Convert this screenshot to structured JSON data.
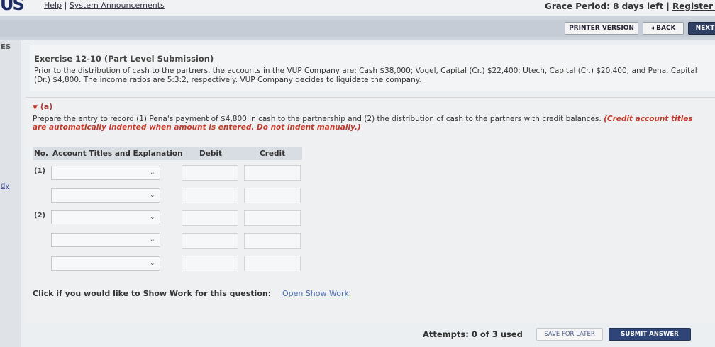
{
  "header": {
    "logo_text": "US",
    "help_link": "Help",
    "separator": "|",
    "announcements_link": "System Announcements",
    "grace_period": "Grace Period: 8 days left",
    "grace_separator": "|",
    "register_link": "Register N"
  },
  "toolbar": {
    "printer_label": "PRINTER VERSION",
    "back_label": "◂ BACK",
    "next_label": "NEXT"
  },
  "sidebar": {
    "top_text": "ES",
    "link_text": "dy"
  },
  "exercise": {
    "title": "Exercise 12-10 (Part Level Submission)",
    "text": "Prior to the distribution of cash to the partners, the accounts in the VUP Company are: Cash $38,000; Vogel, Capital (Cr.) $22,400; Utech, Capital (Cr.) $20,400; and Pena, Capital (Dr.) $4,800. The income ratios are 5:3:2, respectively. VUP Company decides to liquidate the company."
  },
  "part": {
    "label": "(a)",
    "prompt": "Prepare the entry to record (1) Pena's payment of $4,800 in cash to the partnership and (2) the distribution of cash to the partners with credit balances.",
    "note": "(Credit account titles are automatically indented when amount is entered. Do not indent manually.)"
  },
  "journal": {
    "headers": {
      "no": "No.",
      "account": "Account Titles and Explanation",
      "debit": "Debit",
      "credit": "Credit"
    },
    "entries": [
      {
        "number": "(1)",
        "account": "",
        "debit": "",
        "credit": ""
      },
      {
        "number": "",
        "account": "",
        "debit": "",
        "credit": ""
      },
      {
        "number": "(2)",
        "account": "",
        "debit": "",
        "credit": ""
      },
      {
        "number": "",
        "account": "",
        "debit": "",
        "credit": ""
      },
      {
        "number": "",
        "account": "",
        "debit": "",
        "credit": ""
      }
    ]
  },
  "show_work": {
    "label": "Click if you would like to Show Work for this question:",
    "link": "Open Show Work"
  },
  "footer": {
    "attempts": "Attempts: 0 of 3 used",
    "save_label": "SAVE FOR LATER",
    "submit_label": "SUBMIT ANSWER"
  },
  "colors": {
    "accent": "#2f4577",
    "note_red": "#c0392b",
    "link_blue": "#4f6ab0"
  }
}
